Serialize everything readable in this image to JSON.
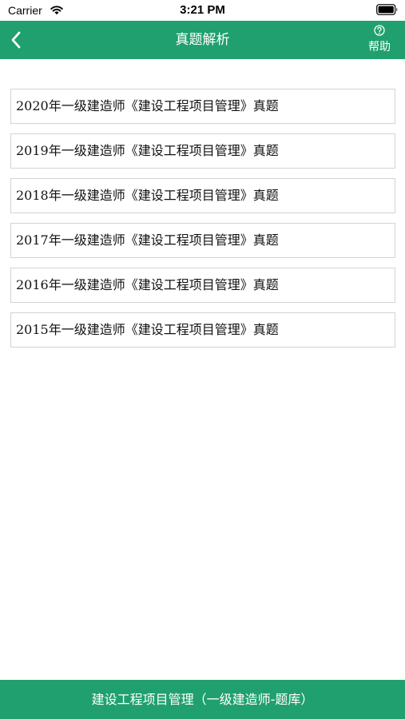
{
  "status_bar": {
    "carrier": "Carrier",
    "time": "3:21 PM",
    "wifi_icon": "wifi-icon",
    "battery_icon": "battery-icon"
  },
  "nav": {
    "title": "真题解析",
    "back_icon": "chevron-left-icon",
    "help_icon": "question-circle-icon",
    "help_label": "帮助"
  },
  "exam_list": [
    "2020年一级建造师《建设工程项目管理》真题",
    "2019年一级建造师《建设工程项目管理》真题",
    "2018年一级建造师《建设工程项目管理》真题",
    "2017年一级建造师《建设工程项目管理》真题",
    "2016年一级建造师《建设工程项目管理》真题",
    "2015年一级建造师《建设工程项目管理》真题"
  ],
  "footer": {
    "label": "建设工程项目管理（一级建造师-题库）"
  },
  "colors": {
    "accent": "#21a06f",
    "list_border": "#d3d3d3",
    "background": "#ffffff"
  }
}
